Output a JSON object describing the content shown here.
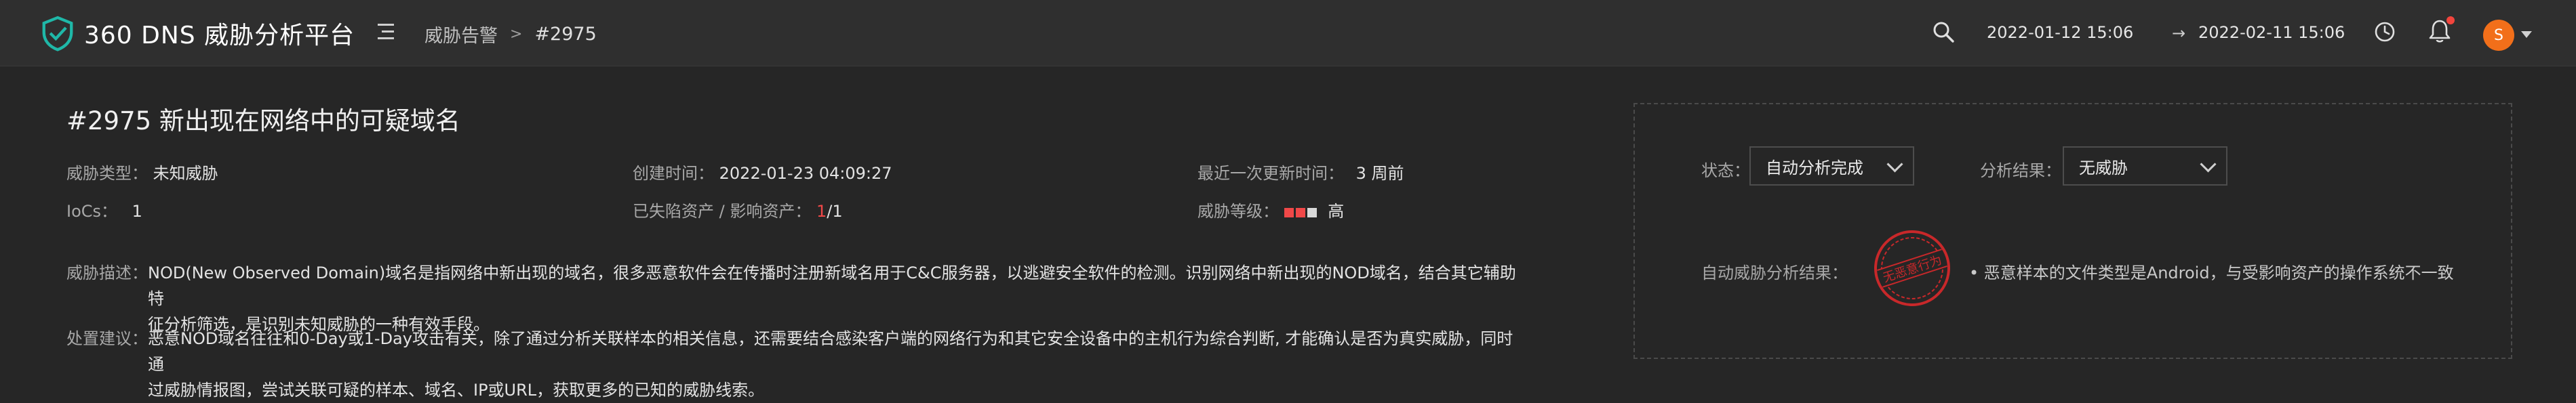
{
  "header": {
    "app_title": "360 DNS 威胁分析平台",
    "breadcrumb_parent": "威胁告警",
    "breadcrumb_sep": ">",
    "breadcrumb_current": "#2975",
    "date_start": "2022-01-12 15:06",
    "date_arrow": "→",
    "date_end": "2022-02-11 15:06",
    "avatar_letter": "S",
    "icons": [
      "shield-logo-icon",
      "menu-icon",
      "search-icon",
      "arrow-right-icon",
      "clock-icon",
      "bell-icon",
      "caret-down-icon"
    ]
  },
  "alert": {
    "title": "#2975 新出现在网络中的可疑域名",
    "threat_type_label": "威胁类型：",
    "threat_type_value": "未知威胁",
    "created_label": "创建时间：",
    "created_value": "2022-01-23 04:09:27",
    "updated_label": "最近一次更新时间：",
    "updated_value": "3 周前",
    "iocs_label": "IoCs：",
    "iocs_value": "1",
    "assets_label": "已失陷资产 / 影响资产：",
    "assets_compromised": "1",
    "assets_slash": "/",
    "assets_total": "1",
    "level_label": "威胁等级：",
    "level_value": "高",
    "level_filled": 2,
    "level_total": 3,
    "desc_label": "威胁描述：",
    "desc_line1": "NOD(New Observed Domain)域名是指网络中新出现的域名，很多恶意软件会在传播时注册新域名用于C&C服务器，以逃避安全软件的检测。识别网络中新出现的NOD域名，结合其它辅助特",
    "desc_line2": "征分析筛选，是识别未知威胁的一种有效手段。",
    "advice_label": "处置建议：",
    "advice_line1": "恶意NOD域名往往和0-Day或1-Day攻击有关，除了通过分析关联样本的相关信息，还需要结合感染客户端的网络行为和其它安全设备中的主机行为综合判断, 才能确认是否为真实威胁，同时通",
    "advice_line2": "过威胁情报图，尝试关联可疑的样本、域名、IP或URL，获取更多的已知的威胁线索。"
  },
  "panel": {
    "status_label": "状态：",
    "status_value": "自动分析完成",
    "result_label": "分析结果：",
    "result_value": "无威胁",
    "auto_label": "自动威胁分析结果：",
    "stamp_text": "无恶意行为",
    "result_text": "• 恶意样本的文件类型是Android，与受影响资产的操作系统不一致"
  },
  "colors": {
    "accent_teal": "#1fb8a8",
    "danger_red": "#f04848",
    "avatar_orange": "#f26f1a",
    "stamp_red": "#c8282a"
  }
}
